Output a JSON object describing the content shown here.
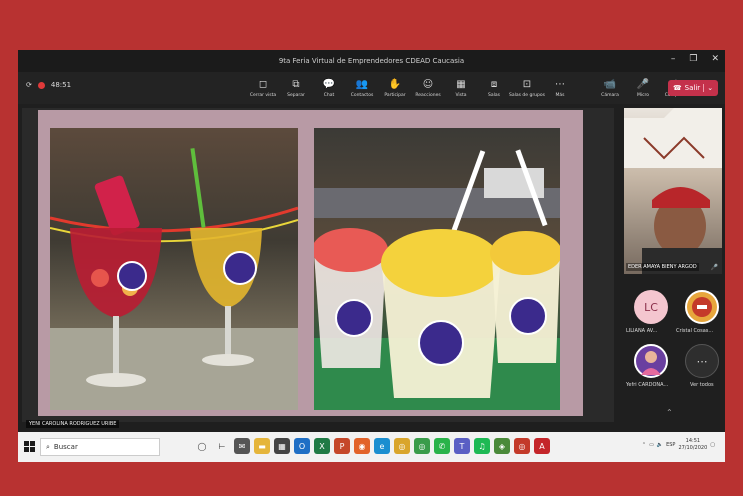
{
  "window": {
    "title": "9ta Feria Virtual de Emprendedores CDEAD Caucasia",
    "controls": [
      "–",
      "❐",
      "✕"
    ]
  },
  "meeting": {
    "timer": "48:51"
  },
  "toolbar": {
    "items": [
      {
        "label": "Cerrar vista",
        "icon": "◻"
      },
      {
        "label": "Separar",
        "icon": "⧉"
      },
      {
        "label": "Chat",
        "icon": "💬"
      },
      {
        "label": "Contactos",
        "icon": "👥"
      },
      {
        "label": "Participar",
        "icon": "✋"
      },
      {
        "label": "Reacciones",
        "icon": "☺"
      },
      {
        "label": "Vista",
        "icon": "▦"
      },
      {
        "label": "Salas",
        "icon": "⧈"
      },
      {
        "label": "Salas de grupos",
        "icon": "⊡"
      },
      {
        "label": "Más",
        "icon": "⋯"
      },
      {
        "label": "Cámara",
        "icon": "📹"
      },
      {
        "label": "Micro",
        "icon": "🎤"
      },
      {
        "label": "Compartir",
        "icon": "⬆"
      }
    ],
    "leave_label": "Salir",
    "leave_icon": "☎"
  },
  "presenter_tag": "YENI CAROLINA RODRIGUEZ URIBE",
  "video": {
    "name": "EDER AMAYA BIENY ARGOD"
  },
  "participants": [
    {
      "initials": "LC",
      "name": "LILIANA AV...",
      "bg": "#f4c6cf",
      "fg": "#8a2f4a"
    },
    {
      "name": "Cristal Cosas...",
      "bg": "#e7a63c"
    },
    {
      "name": "Yefri CARDONA...",
      "bg": "#6a3fa0"
    },
    {
      "initials": "⋯",
      "name": "Ver todos",
      "bg": "#2e2e2e",
      "fg": "#ddd"
    }
  ],
  "taskbar": {
    "search_placeholder": "Buscar",
    "time": "14:51",
    "date": "27/10/2020"
  },
  "colors": {
    "frame_bg": "#b83231",
    "leave": "#c4314b"
  }
}
